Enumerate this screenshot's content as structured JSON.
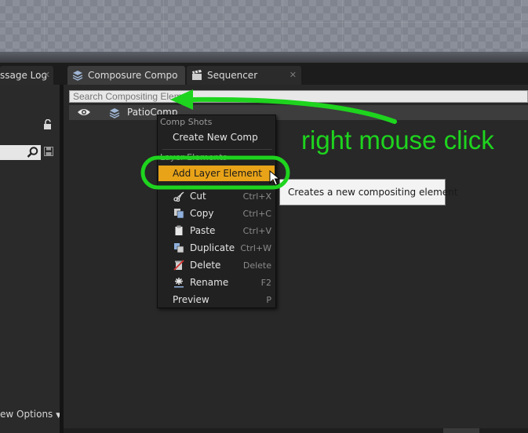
{
  "tabs": [
    {
      "label": "ssage Log"
    },
    {
      "label": "Composure Compo"
    },
    {
      "label": "Sequencer"
    }
  ],
  "search": {
    "placeholder": "Search Compositing Elem"
  },
  "tree": {
    "row_name": "PatioComp"
  },
  "left_panel": {
    "view_options_label": "ew Options"
  },
  "context_menu": {
    "section_comp_shots": "Comp Shots",
    "create_new_comp": "Create New Comp",
    "section_layer_elements": "Layer Elements",
    "add_layer_element": "Add Layer Element",
    "items": [
      {
        "label": "Cut",
        "shortcut": "Ctrl+X",
        "icon": "scissors-icon"
      },
      {
        "label": "Copy",
        "shortcut": "Ctrl+C",
        "icon": "copy-icon"
      },
      {
        "label": "Paste",
        "shortcut": "Ctrl+V",
        "icon": "paste-icon"
      },
      {
        "label": "Duplicate",
        "shortcut": "Ctrl+W",
        "icon": "duplicate-icon"
      },
      {
        "label": "Delete",
        "shortcut": "Delete",
        "icon": "delete-icon"
      },
      {
        "label": "Rename",
        "shortcut": "F2",
        "icon": "rename-icon"
      }
    ],
    "preview": {
      "label": "Preview",
      "shortcut": "P"
    }
  },
  "tooltip": {
    "text": "Creates a new compositing element"
  },
  "annotation": {
    "text": "right mouse click",
    "color": "#1ed41e"
  },
  "colors": {
    "highlight": "#e8a318",
    "annotation_green": "#1ed41e"
  }
}
